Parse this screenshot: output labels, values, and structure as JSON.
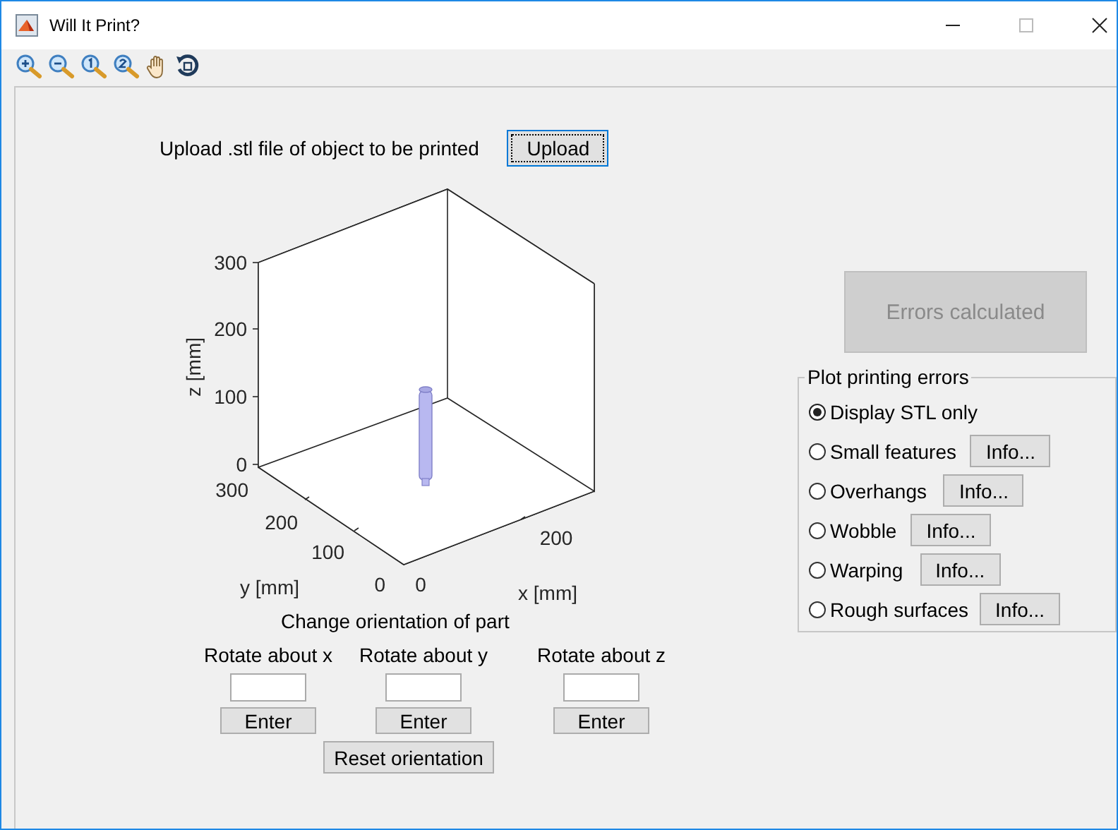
{
  "window": {
    "title": "Will It Print?"
  },
  "toolbar": {
    "tools": [
      {
        "kind": "zoom-in"
      },
      {
        "kind": "zoom-out"
      },
      {
        "kind": "zoom-1"
      },
      {
        "kind": "zoom-2"
      },
      {
        "kind": "pan"
      },
      {
        "kind": "rotate"
      }
    ]
  },
  "upload": {
    "label": "Upload .stl file of object to be printed",
    "button": "Upload"
  },
  "plot": {
    "z_label": "z [mm]",
    "y_label": "y [mm]",
    "x_label": "x [mm]",
    "z_ticks": [
      "300",
      "200",
      "100",
      "0"
    ],
    "y_ticks": [
      "300",
      "200",
      "100",
      "0"
    ],
    "x_ticks": [
      "0",
      "200"
    ]
  },
  "errors_button": {
    "label": "Errors calculated",
    "disabled": true
  },
  "error_group": {
    "title": "Plot printing errors",
    "options": [
      {
        "label": "Display STL only",
        "selected": true
      },
      {
        "label": "Small features",
        "selected": false,
        "info": "Info..."
      },
      {
        "label": "Overhangs",
        "selected": false,
        "info": "Info..."
      },
      {
        "label": "Wobble",
        "selected": false,
        "info": "Info..."
      },
      {
        "label": "Warping",
        "selected": false,
        "info": "Info..."
      },
      {
        "label": "Rough surfaces",
        "selected": false,
        "info": "Info..."
      }
    ]
  },
  "orientation": {
    "title": "Change orientation of part",
    "axes": [
      {
        "label": "Rotate about x",
        "button": "Enter"
      },
      {
        "label": "Rotate about y",
        "button": "Enter"
      },
      {
        "label": "Rotate about z",
        "button": "Enter"
      }
    ],
    "reset": "Reset orientation"
  }
}
